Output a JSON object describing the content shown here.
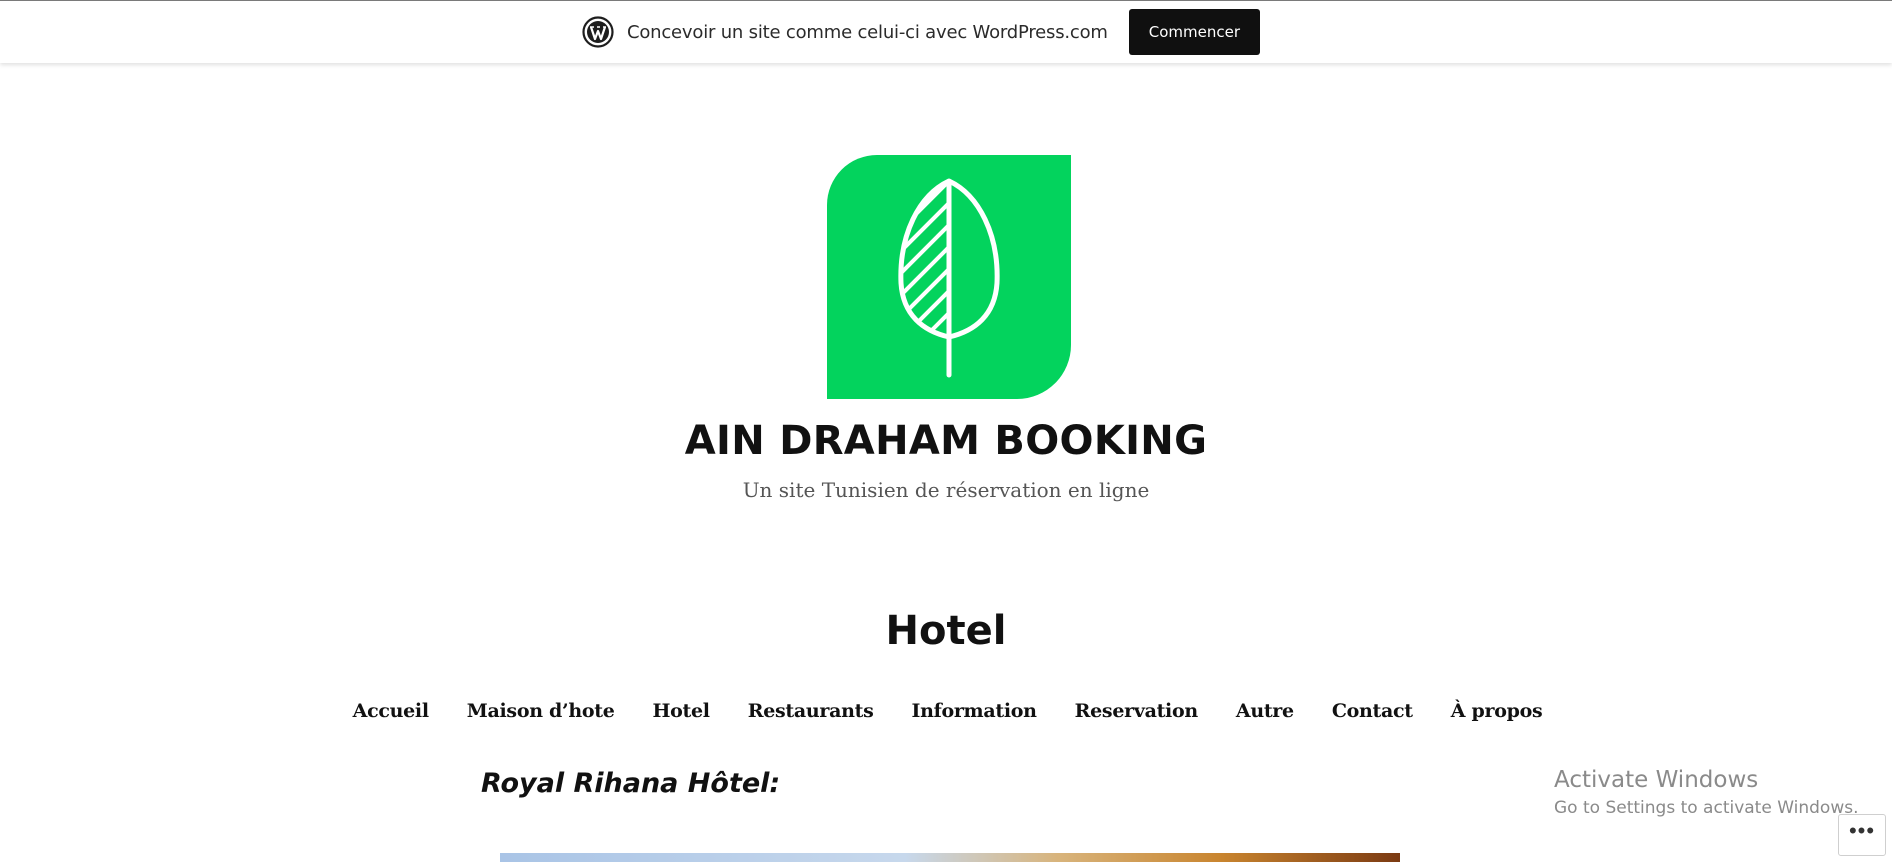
{
  "wp_banner": {
    "text": "Concevoir un site comme celui-ci avec WordPress.com",
    "button_label": "Commencer",
    "logo_icon": "wordpress-logo-icon"
  },
  "site": {
    "logo_icon": "leaf-tree-icon",
    "logo_color": "#03d35d",
    "title": "AIN DRAHAM BOOKING",
    "tagline": "Un site Tunisien de réservation en ligne"
  },
  "page": {
    "title": "Hotel"
  },
  "nav": {
    "items": [
      {
        "label": "Accueil"
      },
      {
        "label": "Maison d’hote"
      },
      {
        "label": "Hotel"
      },
      {
        "label": "Restaurants"
      },
      {
        "label": "Information"
      },
      {
        "label": "Reservation"
      },
      {
        "label": "Autre"
      },
      {
        "label": "Contact"
      },
      {
        "label": "À propos"
      }
    ]
  },
  "post": {
    "heading": "Royal Rihana Hôtel:"
  },
  "windows_watermark": {
    "title": "Activate Windows",
    "subtitle": "Go to Settings to activate Windows."
  },
  "actions_menu": {
    "label": "•••"
  }
}
